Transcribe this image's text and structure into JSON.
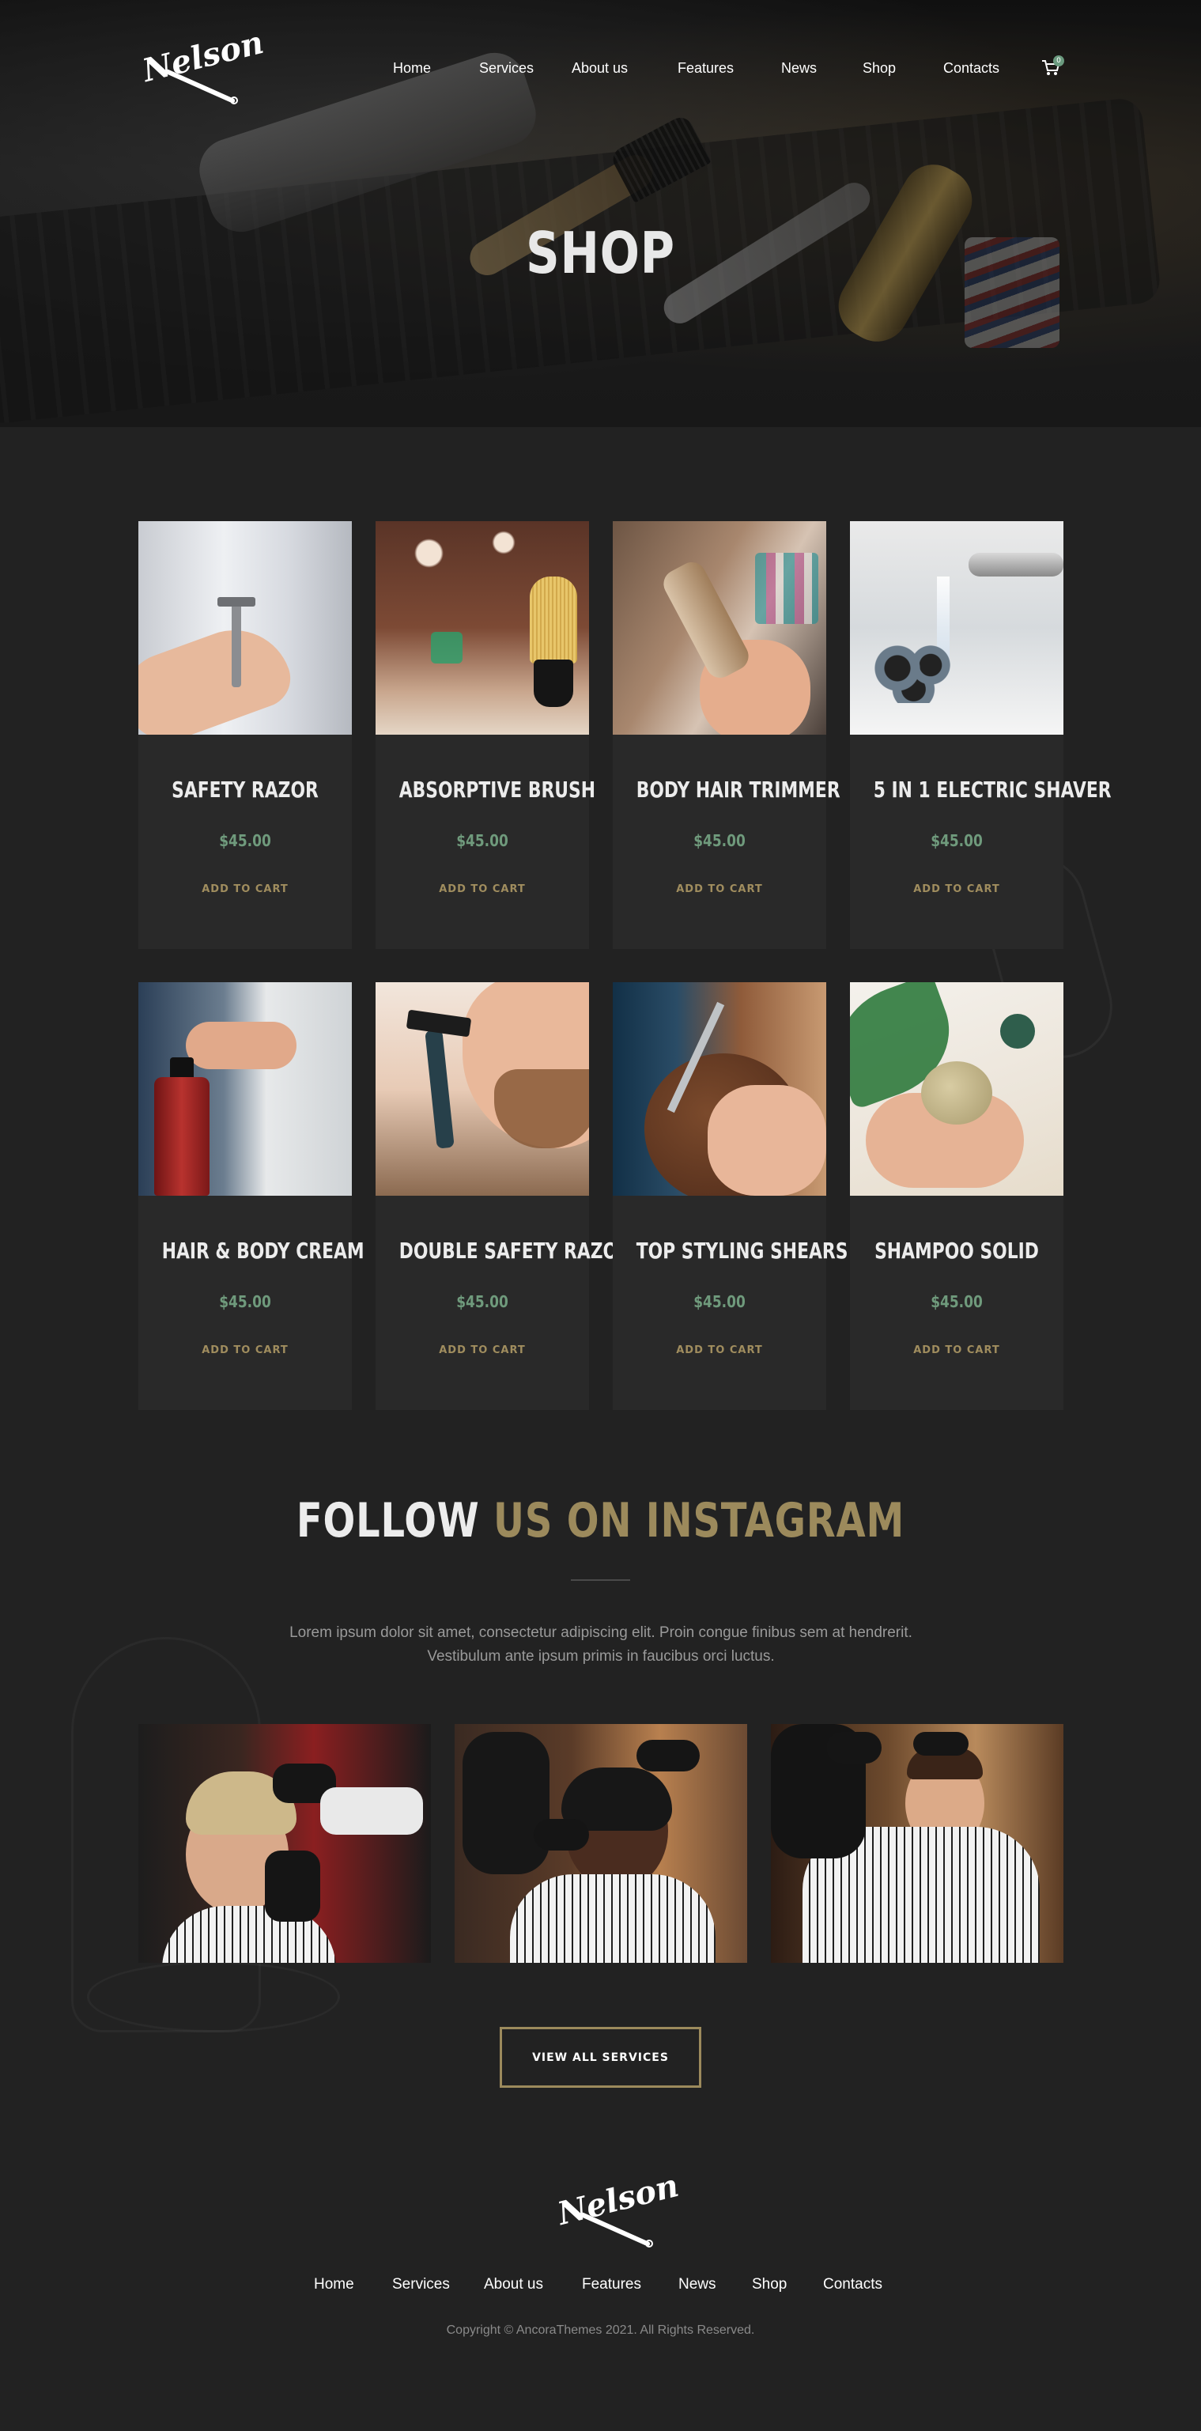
{
  "site": {
    "logo_text": "Nelson"
  },
  "header": {
    "nav": [
      "Home",
      "Services",
      "About us",
      "Features",
      "News",
      "Shop",
      "Contacts"
    ],
    "cart_count": "0"
  },
  "hero": {
    "title": "SHOP"
  },
  "products": [
    {
      "name": "SAFETY RAZOR",
      "price": "$45.00",
      "cta": "ADD TO CART"
    },
    {
      "name": "ABSORPTIVE BRUSH",
      "price": "$45.00",
      "cta": "ADD TO CART"
    },
    {
      "name": "BODY HAIR TRIMMER",
      "price": "$45.00",
      "cta": "ADD TO CART"
    },
    {
      "name": "5 IN 1 ELECTRIC SHAVER",
      "price": "$45.00",
      "cta": "ADD TO CART"
    },
    {
      "name": "HAIR & BODY CREAM",
      "price": "$45.00",
      "cta": "ADD TO CART"
    },
    {
      "name": "DOUBLE SAFETY RAZOR",
      "price": "$45.00",
      "cta": "ADD TO CART"
    },
    {
      "name": "TOP STYLING SHEARS",
      "price": "$45.00",
      "cta": "ADD TO CART"
    },
    {
      "name": "SHAMPOO SOLID",
      "price": "$45.00",
      "cta": "ADD TO CART"
    }
  ],
  "instagram": {
    "title_white": "FOLLOW",
    "title_gold": "US ON INSTAGRAM",
    "text": "Lorem ipsum dolor sit amet, consectetur adipiscing elit. Proin congue finibus sem at hendrerit. Vestibulum ante ipsum primis in faucibus orci luctus.",
    "button": "VIEW ALL SERVICES"
  },
  "footer": {
    "nav": [
      "Home",
      "Services",
      "About us",
      "Features",
      "News",
      "Shop",
      "Contacts"
    ],
    "copyright": "Copyright © AncoraThemes 2021. All Rights Reserved."
  },
  "colors": {
    "background": "#222222",
    "card": "#292929",
    "gold": "#9c8a5c",
    "price_green": "#6f9a7c"
  }
}
